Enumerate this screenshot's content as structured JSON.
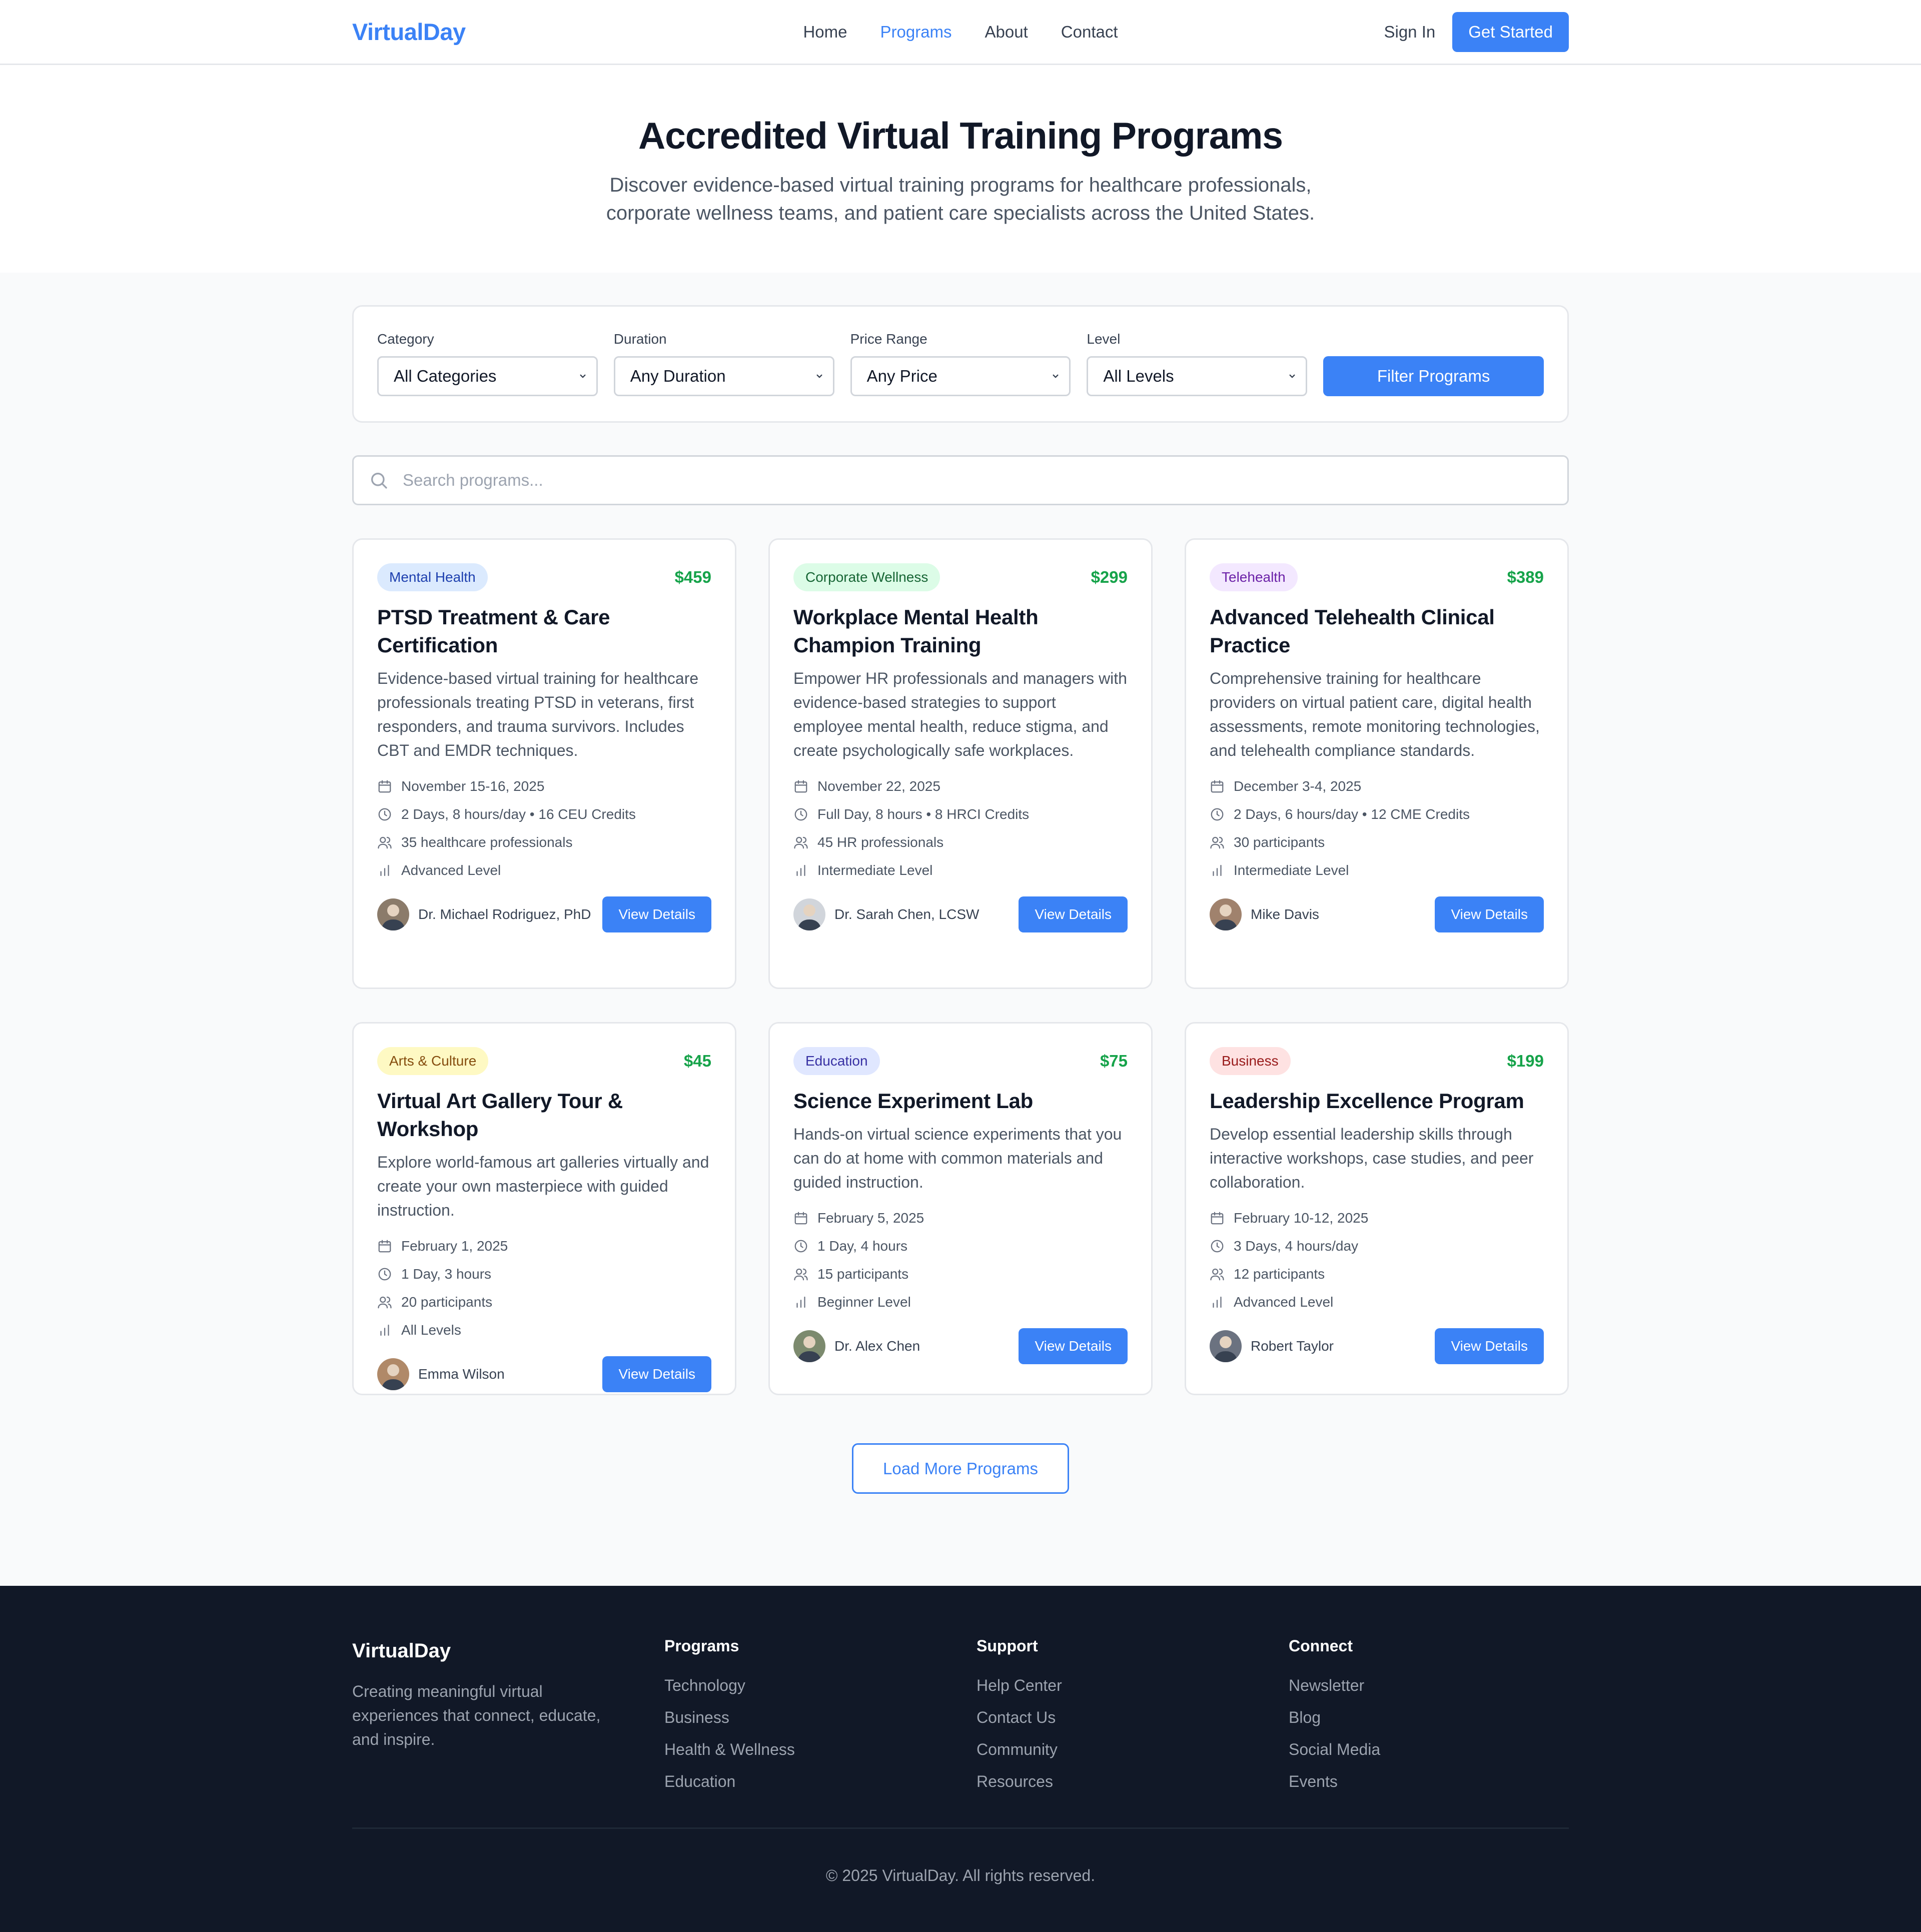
{
  "nav": {
    "logo": "VirtualDay",
    "links": [
      "Home",
      "Programs",
      "About",
      "Contact"
    ],
    "active": "Programs",
    "sign_in": "Sign In",
    "get_started": "Get Started"
  },
  "hero": {
    "title": "Accredited Virtual Training Programs",
    "subtitle": "Discover evidence-based virtual training programs for healthcare professionals, corporate wellness teams, and patient care specialists across the United States."
  },
  "filters": {
    "category": {
      "label": "Category",
      "value": "All Categories"
    },
    "duration": {
      "label": "Duration",
      "value": "Any Duration"
    },
    "price": {
      "label": "Price Range",
      "value": "Any Price"
    },
    "level": {
      "label": "Level",
      "value": "All Levels"
    },
    "button": "Filter Programs"
  },
  "search": {
    "placeholder": "Search programs..."
  },
  "colors": {
    "accent": "#3b82f6",
    "price": "#16a34a"
  },
  "programs": [
    {
      "tag": "Mental Health",
      "tag_bg": "#dbeafe",
      "tag_fg": "#1e40af",
      "price": "$459",
      "title": "PTSD Treatment & Care Certification",
      "description": "Evidence-based virtual training for healthcare professionals treating PTSD in veterans, first responders, and trauma survivors. Includes CBT and EMDR techniques.",
      "date": "November 15-16, 2025",
      "duration": "2 Days, 8 hours/day • 16 CEU Credits",
      "participants": "35 healthcare professionals",
      "level": "Advanced Level",
      "instructor": "Dr. Michael Rodriguez, PhD",
      "button": "View Details"
    },
    {
      "tag": "Corporate Wellness",
      "tag_bg": "#dcfce7",
      "tag_fg": "#166534",
      "price": "$299",
      "title": "Workplace Mental Health Champion Training",
      "description": "Empower HR professionals and managers with evidence-based strategies to support employee mental health, reduce stigma, and create psychologically safe workplaces.",
      "date": "November 22, 2025",
      "duration": "Full Day, 8 hours • 8 HRCI Credits",
      "participants": "45 HR professionals",
      "level": "Intermediate Level",
      "instructor": "Dr. Sarah Chen, LCSW",
      "button": "View Details"
    },
    {
      "tag": "Telehealth",
      "tag_bg": "#f3e8ff",
      "tag_fg": "#6b21a8",
      "price": "$389",
      "title": "Advanced Telehealth Clinical Practice",
      "description": "Comprehensive training for healthcare providers on virtual patient care, digital health assessments, remote monitoring technologies, and telehealth compliance standards.",
      "date": "December 3-4, 2025",
      "duration": "2 Days, 6 hours/day • 12 CME Credits",
      "participants": "30 participants",
      "level": "Intermediate Level",
      "instructor": "Mike Davis",
      "button": "View Details"
    },
    {
      "tag": "Arts & Culture",
      "tag_bg": "#fef9c3",
      "tag_fg": "#854d0e",
      "price": "$45",
      "title": "Virtual Art Gallery Tour & Workshop",
      "description": "Explore world-famous art galleries virtually and create your own masterpiece with guided instruction.",
      "date": "February 1, 2025",
      "duration": "1 Day, 3 hours",
      "participants": "20 participants",
      "level": "All Levels",
      "instructor": "Emma Wilson",
      "button": "View Details"
    },
    {
      "tag": "Education",
      "tag_bg": "#e0e7ff",
      "tag_fg": "#3730a3",
      "price": "$75",
      "title": "Science Experiment Lab",
      "description": "Hands-on virtual science experiments that you can do at home with common materials and guided instruction.",
      "date": "February 5, 2025",
      "duration": "1 Day, 4 hours",
      "participants": "15 participants",
      "level": "Beginner Level",
      "instructor": "Dr. Alex Chen",
      "button": "View Details"
    },
    {
      "tag": "Business",
      "tag_bg": "#fee2e2",
      "tag_fg": "#991b1b",
      "price": "$199",
      "title": "Leadership Excellence Program",
      "description": "Develop essential leadership skills through interactive workshops, case studies, and peer collaboration.",
      "date": "February 10-12, 2025",
      "duration": "3 Days, 4 hours/day",
      "participants": "12 participants",
      "level": "Advanced Level",
      "instructor": "Robert Taylor",
      "button": "View Details"
    }
  ],
  "load_more": "Load More Programs",
  "footer": {
    "logo": "VirtualDay",
    "tagline": "Creating meaningful virtual experiences that connect, educate, and inspire.",
    "columns": [
      {
        "title": "Programs",
        "links": [
          "Technology",
          "Business",
          "Health & Wellness",
          "Education"
        ]
      },
      {
        "title": "Support",
        "links": [
          "Help Center",
          "Contact Us",
          "Community",
          "Resources"
        ]
      },
      {
        "title": "Connect",
        "links": [
          "Newsletter",
          "Blog",
          "Social Media",
          "Events"
        ]
      }
    ],
    "copyright": "© 2025 VirtualDay. All rights reserved."
  }
}
